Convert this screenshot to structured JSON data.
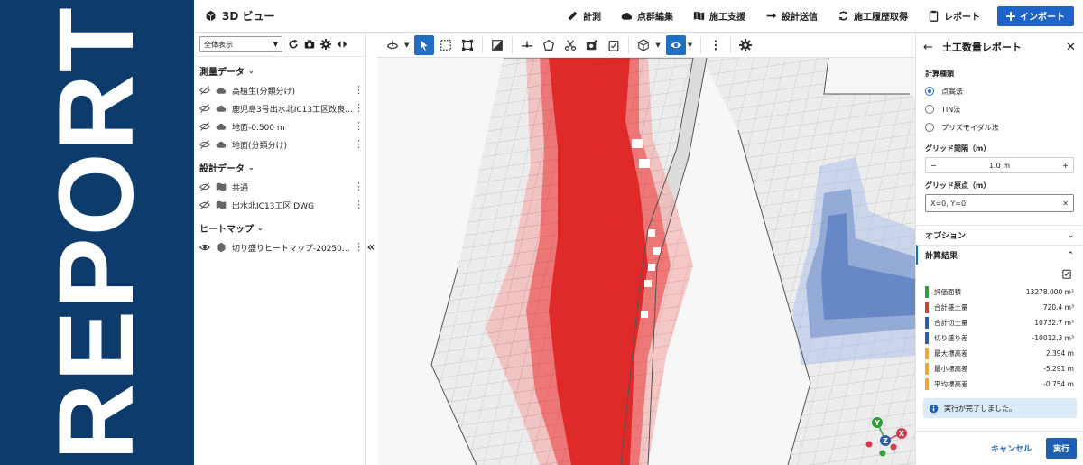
{
  "banner": {
    "text": "REPORT"
  },
  "header": {
    "title": "3D ビュー",
    "menu": [
      {
        "label": "計測",
        "icon": "ruler-icon"
      },
      {
        "label": "点群編集",
        "icon": "cloud-icon"
      },
      {
        "label": "施工支援",
        "icon": "map-icon"
      },
      {
        "label": "設計送信",
        "icon": "arrow-right-icon"
      },
      {
        "label": "施工履歴取得",
        "icon": "sync-icon"
      },
      {
        "label": "レポート",
        "icon": "clipboard-icon"
      }
    ],
    "import_label": "インポート"
  },
  "left_panel": {
    "view_select": "全体表示",
    "sections": [
      {
        "title": "測量データ",
        "items": [
          {
            "name": "高植生(分類分け)",
            "kind": "cloud-icon"
          },
          {
            "name": "鹿児島3号出水北IC13工区改良…",
            "kind": "cloud-icon"
          },
          {
            "name": "地面-0.500 m",
            "kind": "cloud-icon"
          },
          {
            "name": "地面(分類分け)",
            "kind": "cloud-icon"
          }
        ]
      },
      {
        "title": "設計データ",
        "items": [
          {
            "name": "共通",
            "kind": "map-icon"
          },
          {
            "name": "出水北IC13工区.DWG",
            "kind": "map-icon"
          }
        ]
      },
      {
        "title": "ヒートマップ",
        "items": [
          {
            "name": "切り盛りヒートマップ-202503…",
            "kind": "cube-icon"
          }
        ]
      }
    ],
    "collapse_label": "«"
  },
  "right_panel": {
    "title": "土工数量レポート",
    "calc_type_label": "計算種類",
    "calc_types": [
      {
        "label": "点高法",
        "selected": true
      },
      {
        "label": "TIN法",
        "selected": false
      },
      {
        "label": "プリズモイダル法",
        "selected": false
      }
    ],
    "grid_spacing_label": "グリッド間隔（m）",
    "grid_spacing_value": "1.0 m",
    "grid_origin_label": "グリッド原点（m）",
    "grid_origin_value": "X=0, Y=0",
    "options_label": "オプション",
    "results_label": "計算結果",
    "results": [
      {
        "label": "評価面積",
        "value": "13278.000 m²",
        "color": "#2e9e3f"
      },
      {
        "label": "合計盛土量",
        "value": "720.4 m³",
        "color": "#c8443a"
      },
      {
        "label": "合計切土量",
        "value": "10732.7 m³",
        "color": "#2c5ea8"
      },
      {
        "label": "切り盛り差",
        "value": "-10012.3 m³",
        "color": "#2c5ea8"
      },
      {
        "label": "最大標高差",
        "value": "2.394 m",
        "color": "#f2a530"
      },
      {
        "label": "最小標高差",
        "value": "-5.291 m",
        "color": "#f2a530"
      },
      {
        "label": "平均標高差",
        "value": "-0.754 m",
        "color": "#f2a530"
      }
    ],
    "status_text": "実行が完了しました。",
    "cancel_label": "キャンセル",
    "run_label": "実行"
  },
  "axes": {
    "y": "Y",
    "z": "Z",
    "x": "X"
  },
  "colors": {
    "brand": "#0d3b6b",
    "accent": "#1f6fc5",
    "fill": "#e23b3b",
    "cut": "#5b7fc2"
  }
}
